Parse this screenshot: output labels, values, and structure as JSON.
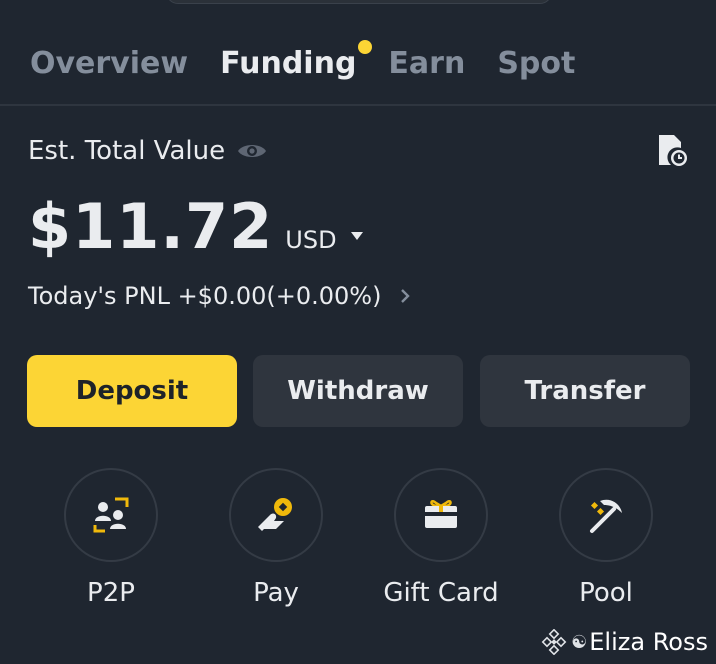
{
  "tabs": [
    {
      "label": "Overview",
      "active": false
    },
    {
      "label": "Funding",
      "active": true,
      "badge": true
    },
    {
      "label": "Earn",
      "active": false
    },
    {
      "label": "Spot",
      "active": false
    }
  ],
  "balance": {
    "label": "Est. Total Value",
    "amount": "$11.72",
    "currency": "USD",
    "pnl": "Today's PNL +$0.00(+0.00%)"
  },
  "actions": {
    "deposit": "Deposit",
    "withdraw": "Withdraw",
    "transfer": "Transfer"
  },
  "shortcuts": [
    {
      "label": "P2P",
      "icon": "p2p-icon"
    },
    {
      "label": "Pay",
      "icon": "pay-icon"
    },
    {
      "label": "Gift Card",
      "icon": "gift-card-icon"
    },
    {
      "label": "Pool",
      "icon": "pickaxe-icon"
    }
  ],
  "watermark": {
    "name": "Eliza Ross"
  },
  "colors": {
    "background": "#1f2630",
    "accent": "#fcd535",
    "secondary_button": "#2f353e",
    "muted_text": "#848e9c",
    "text": "#eaecef"
  }
}
